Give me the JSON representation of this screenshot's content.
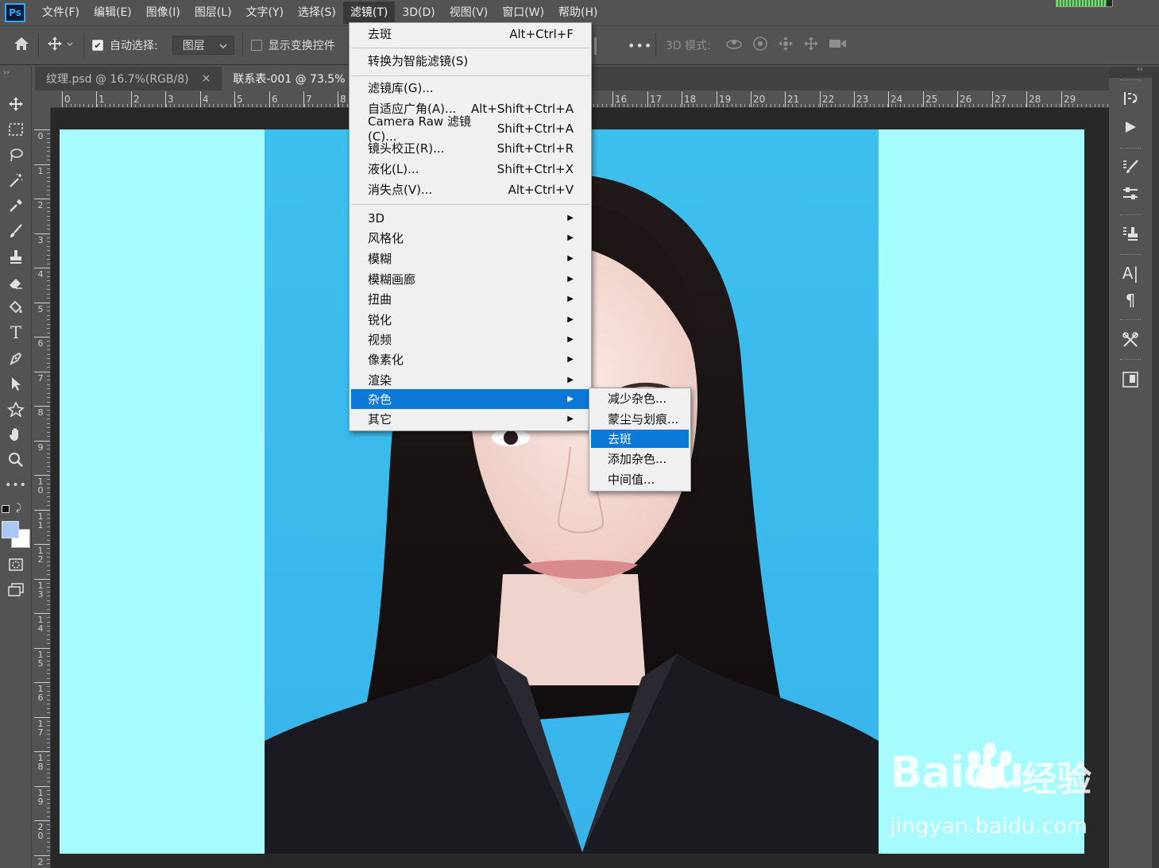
{
  "app": {
    "logo": "Ps"
  },
  "menubar": {
    "items": [
      "文件(F)",
      "编辑(E)",
      "图像(I)",
      "图层(L)",
      "文字(Y)",
      "选择(S)",
      "滤镜(T)",
      "3D(D)",
      "视图(V)",
      "窗口(W)",
      "帮助(H)"
    ],
    "active_index": 6,
    "progress_fill": 0.9
  },
  "options": {
    "auto_select_label": "自动选择:",
    "auto_select_checked": true,
    "target_value": "图层",
    "transform_controls_label": "显示变换控件",
    "transform_controls_checked": false,
    "more_label": "•••",
    "mode_3d_label": "3D 模式:"
  },
  "tabs": [
    {
      "label": "纹理.psd @ 16.7%(RGB/8)",
      "close": "×",
      "active": false
    },
    {
      "label": "联系表-001 @ 73.5% (图",
      "close": "",
      "active": true
    }
  ],
  "ruler": {
    "h_labels": [
      "0",
      "1",
      "2",
      "3",
      "4",
      "5",
      "6",
      "7",
      "8",
      "16",
      "17",
      "18",
      "19",
      "20",
      "21",
      "22",
      "23",
      "24",
      "25",
      "26",
      "27",
      "28",
      "29"
    ],
    "v_labels": [
      "0",
      "1",
      "2",
      "3",
      "4",
      "5",
      "6",
      "7",
      "8",
      "9",
      "10",
      "11",
      "12",
      "13",
      "14",
      "15",
      "16",
      "17",
      "18",
      "19",
      "20",
      "2"
    ]
  },
  "filter_menu": {
    "last_filter": {
      "label": "去斑",
      "shortcut": "Alt+Ctrl+F"
    },
    "smart_filter": {
      "label": "转换为智能滤镜(S)"
    },
    "group1": [
      {
        "label": "滤镜库(G)...",
        "shortcut": ""
      },
      {
        "label": "自适应广角(A)...",
        "shortcut": "Alt+Shift+Ctrl+A"
      },
      {
        "label": "Camera Raw 滤镜(C)...",
        "shortcut": "Shift+Ctrl+A"
      },
      {
        "label": "镜头校正(R)...",
        "shortcut": "Shift+Ctrl+R"
      },
      {
        "label": "液化(L)...",
        "shortcut": "Shift+Ctrl+X"
      },
      {
        "label": "消失点(V)...",
        "shortcut": "Alt+Ctrl+V"
      }
    ],
    "submenus": [
      {
        "label": "3D",
        "highlighted": false
      },
      {
        "label": "风格化",
        "highlighted": false
      },
      {
        "label": "模糊",
        "highlighted": false
      },
      {
        "label": "模糊画廊",
        "highlighted": false
      },
      {
        "label": "扭曲",
        "highlighted": false
      },
      {
        "label": "锐化",
        "highlighted": false
      },
      {
        "label": "视频",
        "highlighted": false
      },
      {
        "label": "像素化",
        "highlighted": false
      },
      {
        "label": "渲染",
        "highlighted": false
      },
      {
        "label": "杂色",
        "highlighted": true
      },
      {
        "label": "其它",
        "highlighted": false
      }
    ]
  },
  "noise_submenu": [
    {
      "label": "减少杂色...",
      "highlighted": false
    },
    {
      "label": "蒙尘与划痕...",
      "highlighted": false
    },
    {
      "label": "去斑",
      "highlighted": true
    },
    {
      "label": "添加杂色...",
      "highlighted": false
    },
    {
      "label": "中间值...",
      "highlighted": false
    }
  ],
  "watermark": {
    "brand": "Baidu",
    "cn": "经验",
    "url": "jingyan.baidu.com"
  },
  "colors": {
    "highlight": "#0a78d7",
    "canvas_bg": "#a6fbfe",
    "photo_bg": "#3ec0ee",
    "ui_bg": "#535353"
  },
  "icons": {
    "toolbar": [
      "move-icon",
      "marquee-icon",
      "lasso-icon",
      "magic-wand-icon",
      "eyedropper-icon",
      "brush-icon",
      "stamp-icon",
      "eraser-icon",
      "paint-bucket-icon",
      "type-icon",
      "pen-icon",
      "path-select-icon",
      "custom-shape-icon",
      "hand-icon",
      "zoom-icon",
      "more-tools-icon"
    ],
    "right_panel": [
      "history-icon",
      "play-icon",
      "brush-settings-icon",
      "adjustments-icon",
      "clone-source-icon",
      "character-icon",
      "paragraph-icon",
      "tools-icon",
      "libraries-icon"
    ]
  }
}
